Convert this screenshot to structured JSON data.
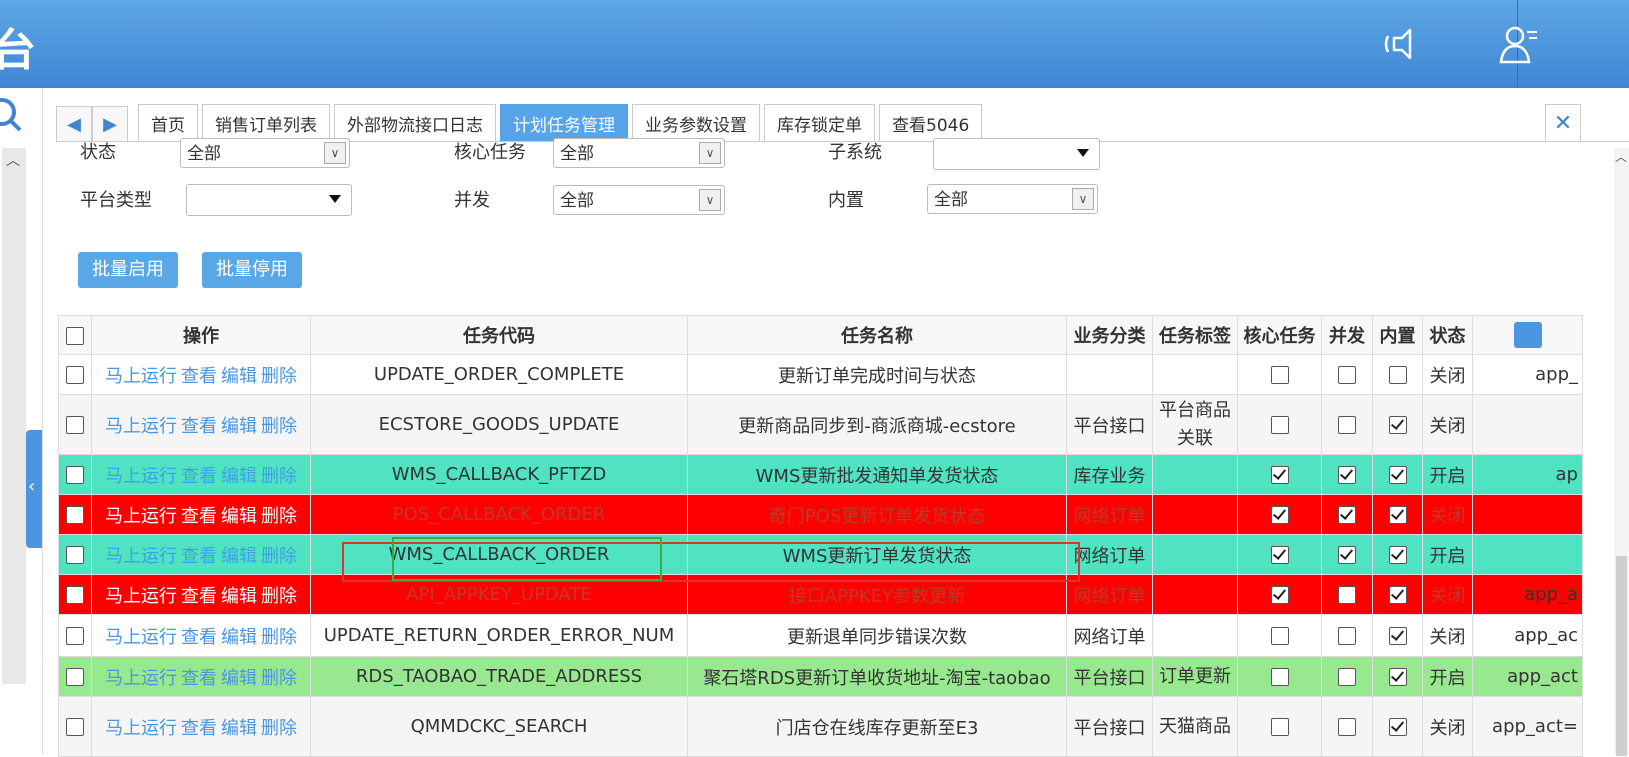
{
  "header": {
    "logo_char": "台"
  },
  "tabs": [
    "首页",
    "销售订单列表",
    "外部物流接口日志",
    "计划任务管理",
    "业务参数设置",
    "库存锁定单",
    "查看5046"
  ],
  "active_tab": 3,
  "filters": {
    "status_label": "状态",
    "status_value": "全部",
    "core_label": "核心任务",
    "core_value": "全部",
    "subsystem_label": "子系统",
    "subsystem_value": "",
    "platform_label": "平台类型",
    "platform_value": "",
    "concurrent_label": "并发",
    "concurrent_value": "全部",
    "builtin_label": "内置",
    "builtin_value": "全部"
  },
  "actions": {
    "enable": "批量启用",
    "disable": "批量停用"
  },
  "table": {
    "columns": [
      "操作",
      "任务代码",
      "任务名称",
      "业务分类",
      "任务标签",
      "核心任务",
      "并发",
      "内置",
      "状态"
    ],
    "op_links": [
      "马上运行",
      "查看",
      "编辑",
      "删除"
    ],
    "rows": [
      {
        "code": "UPDATE_ORDER_COMPLETE",
        "name": "更新订单完成时间与状态",
        "category": "",
        "tag": "",
        "core": false,
        "concurrent": false,
        "builtin": false,
        "status": "关闭",
        "extra": "app_"
      },
      {
        "code": "ECSTORE_GOODS_UPDATE",
        "name": "更新商品同步到-商派商城-ecstore",
        "category": "平台接口",
        "tag": "平台商品关联",
        "core": false,
        "concurrent": false,
        "builtin": true,
        "status": "关闭",
        "extra": ""
      },
      {
        "code": "WMS_CALLBACK_PFTZD",
        "name": "WMS更新批发通知单发货状态",
        "category": "库存业务",
        "tag": "",
        "core": true,
        "concurrent": true,
        "builtin": true,
        "status": "开启",
        "extra": "ap"
      },
      {
        "code": "POS_CALLBACK_ORDER",
        "name": "奇门POS更新订单发货状态",
        "category": "网络订单",
        "tag": "",
        "core": true,
        "concurrent": true,
        "builtin": true,
        "status": "关闭",
        "extra": ""
      },
      {
        "code": "WMS_CALLBACK_ORDER",
        "name": "WMS更新订单发货状态",
        "category": "网络订单",
        "tag": "",
        "core": true,
        "concurrent": true,
        "builtin": true,
        "status": "开启",
        "extra": ""
      },
      {
        "code": "API_APPKEY_UPDATE",
        "name": "接口APPKEY参数更新",
        "category": "网络订单",
        "tag": "",
        "core": true,
        "concurrent": false,
        "builtin": true,
        "status": "关闭",
        "extra": "app_a"
      },
      {
        "code": "UPDATE_RETURN_ORDER_ERROR_NUM",
        "name": "更新退单同步错误次数",
        "category": "网络订单",
        "tag": "",
        "core": false,
        "concurrent": false,
        "builtin": true,
        "status": "关闭",
        "extra": "app_ac"
      },
      {
        "code": "RDS_TAOBAO_TRADE_ADDRESS",
        "name": "聚石塔RDS更新订单收货地址-淘宝-taobao",
        "category": "平台接口",
        "tag": "订单更新",
        "core": false,
        "concurrent": false,
        "builtin": true,
        "status": "开启",
        "extra": "app_act"
      },
      {
        "code": "QMMDCKC_SEARCH",
        "name": "门店仓在线库存更新至E3",
        "category": "平台接口",
        "tag": "天猫商品",
        "core": false,
        "concurrent": false,
        "builtin": true,
        "status": "关闭",
        "extra": "app_act="
      }
    ]
  }
}
